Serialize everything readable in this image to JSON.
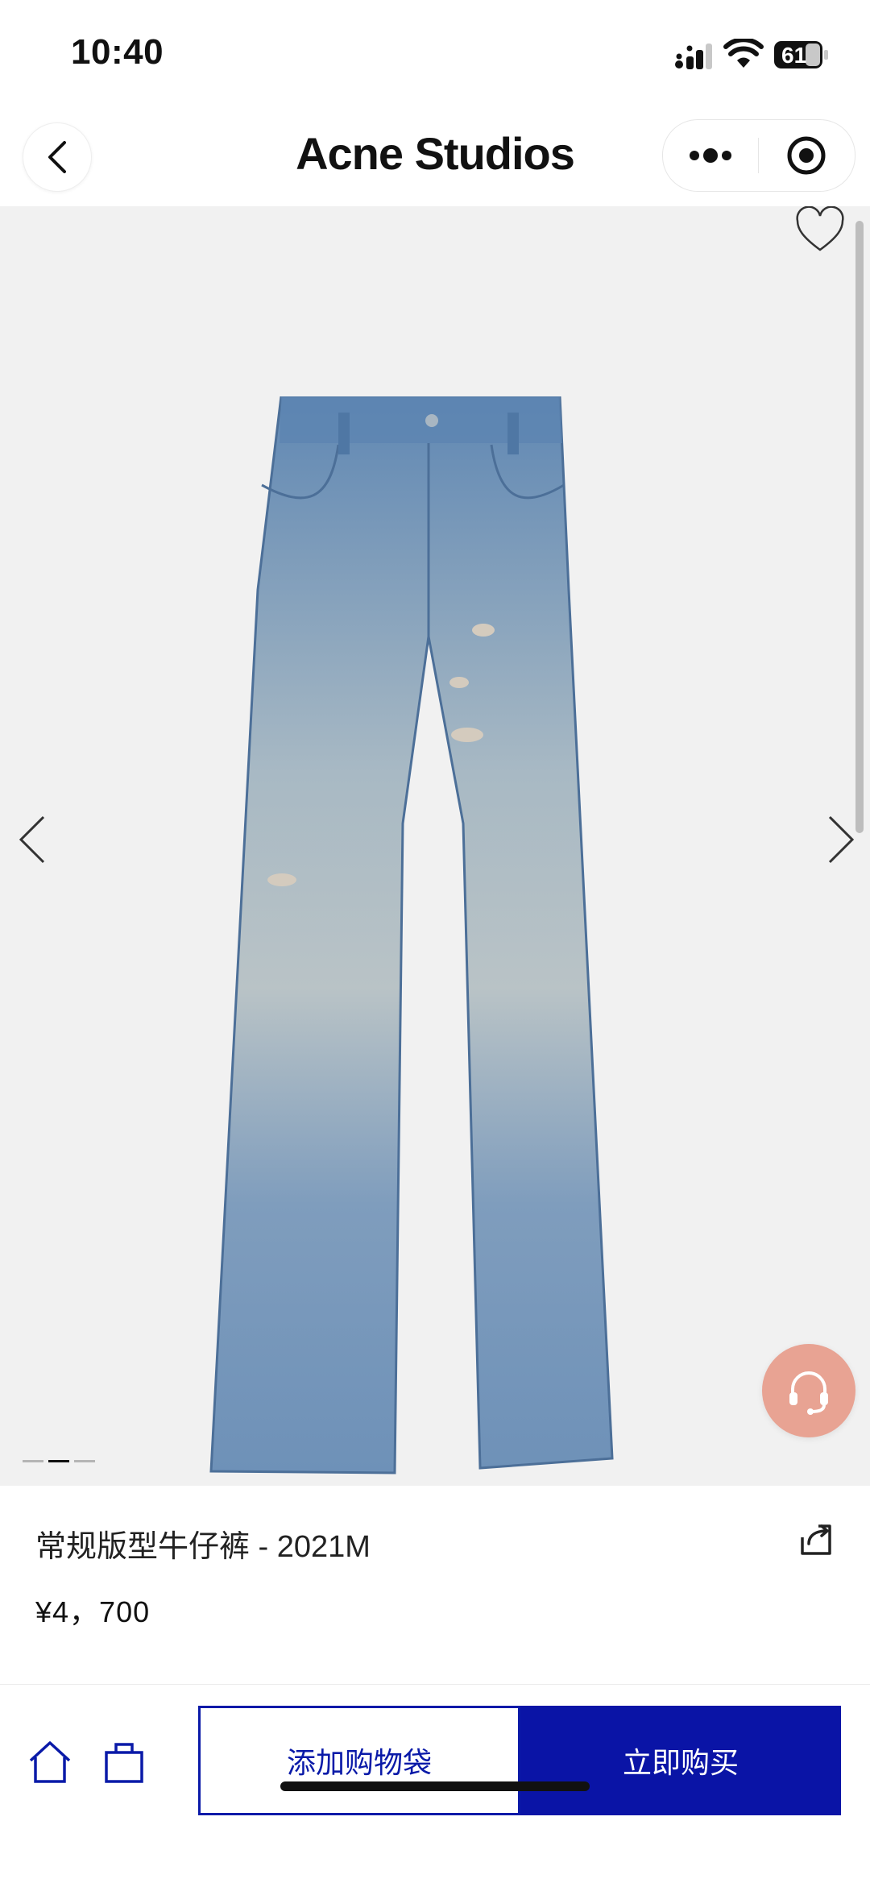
{
  "status_bar": {
    "time": "10:40",
    "battery": "61"
  },
  "nav": {
    "brand": "Acne Studios"
  },
  "product": {
    "title": "常规版型牛仔裤 - 2021M",
    "price": "¥4，700"
  },
  "gallery": {
    "page_count": 3,
    "active_page": 2
  },
  "actions": {
    "add_to_bag": "添加购物袋",
    "buy_now": "立即购买"
  },
  "colors": {
    "accent": "#0a14a6",
    "gallery_bg": "#f1f1f1",
    "support_button": "#e8a393"
  },
  "icons": [
    "back-icon",
    "more-icon",
    "target-icon",
    "heart-icon",
    "chevron-left-icon",
    "chevron-right-icon",
    "headset-icon",
    "share-icon",
    "home-icon",
    "bag-icon"
  ]
}
